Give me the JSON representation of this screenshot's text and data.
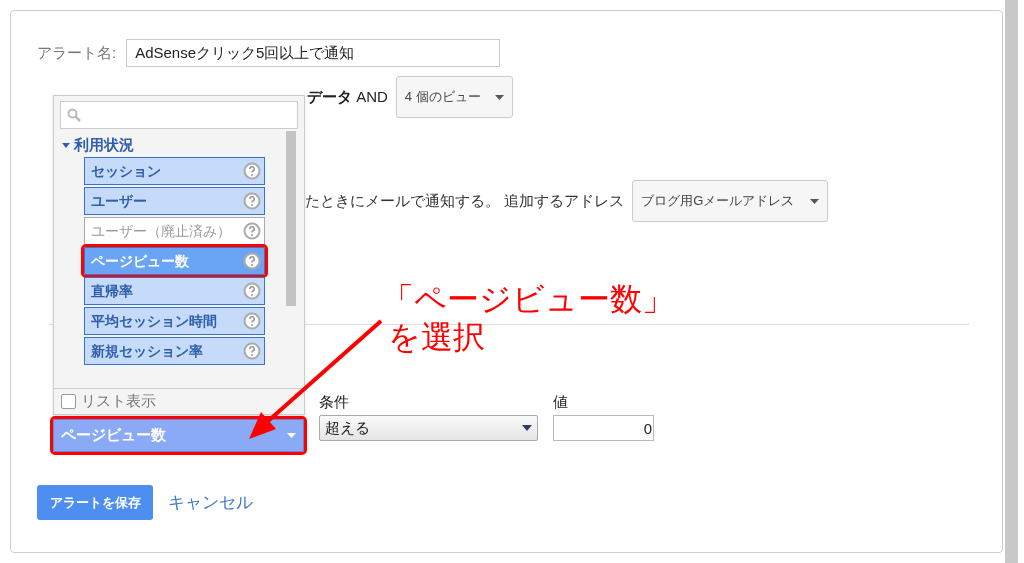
{
  "alert_name": {
    "label": "アラート名:",
    "value": "AdSenseクリック5回以上で通知"
  },
  "apply": {
    "text": "**データ** AND",
    "views_dropdown": "4 個のビュー"
  },
  "notify": {
    "text": "たときにメールで通知する。 追加するアドレス",
    "address_dropdown": "ブログ用Gメールアドレス"
  },
  "metric_picker": {
    "category": {
      "label": "利用状況",
      "expanded": true
    },
    "items": [
      {
        "label": "セッション",
        "selected": false,
        "disabled": false,
        "annotated": false
      },
      {
        "label": "ユーザー",
        "selected": false,
        "disabled": false,
        "annotated": false
      },
      {
        "label": "ユーザー（廃止済み）",
        "selected": false,
        "disabled": true,
        "annotated": false
      },
      {
        "label": "ページビュー数",
        "selected": true,
        "disabled": false,
        "annotated": true
      },
      {
        "label": "直帰率",
        "selected": false,
        "disabled": false,
        "annotated": false
      },
      {
        "label": "平均セッション時間",
        "selected": false,
        "disabled": false,
        "annotated": false
      },
      {
        "label": "新規セッション率",
        "selected": false,
        "disabled": false,
        "annotated": false
      }
    ],
    "list_view": {
      "label": "リスト表示",
      "checked": false
    },
    "value": "ページビュー数"
  },
  "condition": {
    "label": "条件",
    "value": "超える"
  },
  "threshold": {
    "label": "値",
    "value": "0"
  },
  "annotation": {
    "line1": "「ページビュー数」",
    "line2": "を選択"
  },
  "buttons": {
    "save": "アラートを保存",
    "cancel": "キャンセル"
  }
}
